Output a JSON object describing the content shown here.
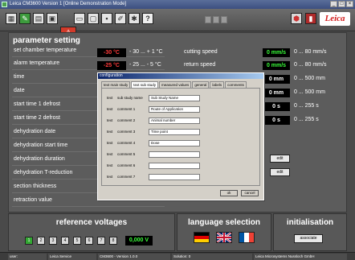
{
  "window": {
    "title": "Leica CM3600 Version 1 [Online Demonstration Mode]",
    "buttons": [
      "_",
      "□",
      "×"
    ]
  },
  "toolbar": {
    "icons": [
      "display-icon",
      "pen-icon",
      "chart-icon",
      "sample-icon",
      "warning-icon",
      "printer-icon",
      "monitor-icon",
      "save-icon",
      "pencil-icon",
      "tools-icon",
      "help-icon"
    ],
    "help_label": "?",
    "logo_text": "Leica"
  },
  "params": {
    "heading": "parameter setting",
    "left": [
      {
        "label": "set chamber temperature",
        "value": "-30 °C",
        "range": "- 30 ... + 1 °C"
      },
      {
        "label": "alarm temperature",
        "value": "-25 °C",
        "range": "- 25 ... - 5 °C"
      },
      {
        "label": "time",
        "value": "",
        "range": ""
      },
      {
        "label": "date",
        "value": "",
        "range": ""
      },
      {
        "label": "start time 1 defrost",
        "value": "",
        "range": ""
      },
      {
        "label": "start time 2 defrost",
        "value": "",
        "range": ""
      },
      {
        "label": "dehydration date",
        "value": "",
        "range": ""
      },
      {
        "label": "dehydration start time",
        "value": "",
        "range": ""
      },
      {
        "label": "dehydration duration",
        "value": "",
        "range": ""
      },
      {
        "label": "dehydration T-reduction",
        "value": "",
        "range": ""
      },
      {
        "label": "section thickness",
        "value": "",
        "range": ""
      },
      {
        "label": "retraction value",
        "value": "",
        "range": ""
      }
    ],
    "right": [
      {
        "label": "cutting speed",
        "value": "0 mm/s",
        "range": "0 ... 80 mm/s"
      },
      {
        "label": "return speed",
        "value": "0 mm/s",
        "range": "0 ... 80 mm/s"
      },
      {
        "label": "",
        "value": "0 mm",
        "range": "0 ... 500 mm"
      },
      {
        "label": "",
        "value": "0 mm",
        "range": "0 ... 500 mm"
      },
      {
        "label": "",
        "value": "0 s",
        "range": "0 ... 255 s"
      },
      {
        "label": "",
        "value": "0 s",
        "range": "0 ... 255 s"
      }
    ],
    "edit_label": "edit"
  },
  "dialog": {
    "title": "configuration",
    "tabs": [
      "text main study",
      "text sub study",
      "measured values",
      "general",
      "labels",
      "comments"
    ],
    "selected_tab": 1,
    "fields": [
      {
        "prefix": "text",
        "name": "sub study name",
        "value": "Sub Study Name"
      },
      {
        "prefix": "text",
        "name": "comment 1",
        "value": "Route of Application"
      },
      {
        "prefix": "text",
        "name": "comment 2",
        "value": "Animal number"
      },
      {
        "prefix": "text",
        "name": "comment 3",
        "value": "Time point"
      },
      {
        "prefix": "text",
        "name": "comment 4",
        "value": "Dose"
      },
      {
        "prefix": "text",
        "name": "comment 5",
        "value": ""
      },
      {
        "prefix": "text",
        "name": "comment 6",
        "value": ""
      },
      {
        "prefix": "text",
        "name": "comment 7",
        "value": ""
      }
    ],
    "ok_label": "ok",
    "cancel_label": "cancel"
  },
  "reference": {
    "title": "reference voltages",
    "buttons": [
      "1",
      "2",
      "3",
      "4",
      "5",
      "6",
      "7",
      "8"
    ],
    "active": 0,
    "value": "0,000 V"
  },
  "language": {
    "title": "language selection",
    "flags": [
      "german-flag-icon",
      "uk-flag-icon",
      "french-flag-icon"
    ]
  },
  "init": {
    "title": "initialisation",
    "button": "associate"
  },
  "status": [
    {
      "text": "user:"
    },
    {
      "text": "Leica Service"
    },
    {
      "text": "CM3600 - Version 1.0.0"
    },
    {
      "text": "Solution: 0"
    },
    {
      "text": "Leica Microsystems Nussloch GmbH"
    }
  ],
  "colors": {
    "accent_green": "#3d9c3d",
    "value_red": "#ff3a3a",
    "value_green": "#3aff3a",
    "leica_red": "#d42020"
  }
}
